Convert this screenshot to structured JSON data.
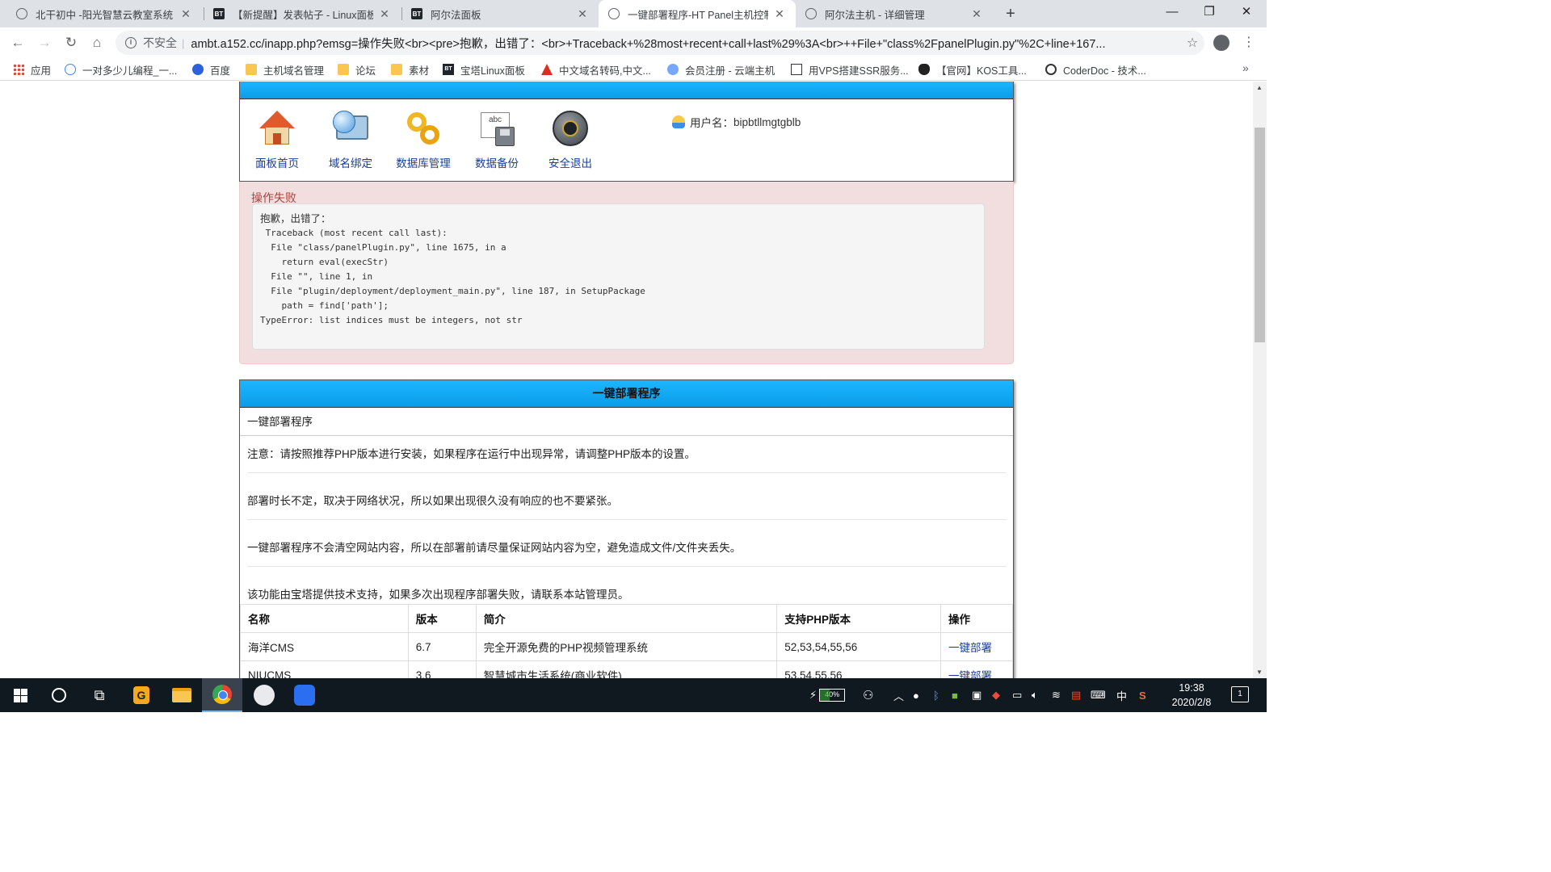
{
  "browser": {
    "tabs": [
      {
        "title": "北干初中 -阳光智慧云教室系统",
        "icon": "globe-icon"
      },
      {
        "title": "【新提醒】发表帖子 - Linux面板",
        "icon": "bt-icon"
      },
      {
        "title": "阿尔法面板",
        "icon": "bt-icon"
      },
      {
        "title": "一键部署程序-HT Panel主机控制",
        "icon": "globe-icon"
      },
      {
        "title": "阿尔法主机 - 详细管理",
        "icon": "globe-icon"
      }
    ],
    "active_tab": 3,
    "insecure_label": "不安全",
    "url": "ambt.a152.cc/inapp.php?emsg=操作失败<br><pre>抱歉，出错了：<br>+Traceback+%28most+recent+call+last%29%3A<br>++File+\"class%2FpanelPlugin.py\"%2C+line+167...",
    "bookmarks": [
      {
        "label": "应用",
        "icon": "apps-icon"
      },
      {
        "label": "一对多少儿编程_一...",
        "icon": "globe-icon"
      },
      {
        "label": "百度",
        "icon": "paw-icon"
      },
      {
        "label": "主机域名管理",
        "icon": "folder-icon"
      },
      {
        "label": "论坛",
        "icon": "folder-icon"
      },
      {
        "label": "素材",
        "icon": "folder-icon"
      },
      {
        "label": "宝塔Linux面板",
        "icon": "bt-icon"
      },
      {
        "label": "中文域名转码,中文...",
        "icon": "red-icon"
      },
      {
        "label": "会员注册 - 云端主机",
        "icon": "cloud-icon"
      },
      {
        "label": "用VPS搭建SSR服务...",
        "icon": "doc-icon"
      },
      {
        "label": "【官网】KOS工具...",
        "icon": "penguin-icon"
      },
      {
        "label": "CoderDoc - 技术...",
        "icon": "ring-icon"
      }
    ]
  },
  "panel_nav": {
    "items": [
      {
        "label": "面板首页",
        "icon": "home-icon"
      },
      {
        "label": "域名绑定",
        "icon": "globe-monitor-icon"
      },
      {
        "label": "数据库管理",
        "icon": "chain-icon"
      },
      {
        "label": "数据备份",
        "icon": "backup-disk-icon"
      },
      {
        "label": "安全退出",
        "icon": "power-icon"
      }
    ],
    "user_label": "用户名：",
    "username": "bipbtllmgtgblb"
  },
  "error": {
    "title": "操作失败",
    "lines": [
      "抱歉，出错了：",
      " Traceback (most recent call last):",
      "  File \"class/panelPlugin.py\", line 1675, in a",
      "    return eval(execStr)",
      "  File \"\", line 1, in",
      "  File \"plugin/deployment/deployment_main.py\", line 187, in SetupPackage",
      "    path = find['path'];",
      "TypeError: list indices must be integers, not str"
    ]
  },
  "deploy": {
    "header": "一键部署程序",
    "subtitle": "一键部署程序",
    "notes": [
      "注意：请按照推荐PHP版本进行安装，如果程序在运行中出现异常，请调整PHP版本的设置。",
      "部署时长不定，取决于网络状况，所以如果出现很久没有响应的也不要紧张。",
      "一键部署程序不会清空网站内容，所以在部署前请尽量保证网站内容为空，避免造成文件/文件夹丢失。",
      "该功能由宝塔提供技术支持，如果多次出现程序部署失败，请联系本站管理员。"
    ],
    "columns": [
      "名称",
      "版本",
      "简介",
      "支持PHP版本",
      "操作"
    ],
    "rows": [
      {
        "name": "海洋CMS",
        "version": "6.7",
        "desc": "完全开源免费的PHP视频管理系统",
        "php": "52,53,54,55,56",
        "action": "一键部署"
      },
      {
        "name": "NIUCMS",
        "version": "3.6",
        "desc": "智慧城市生活系统(商业软件)",
        "php": "53,54,55,56",
        "action": "一键部署"
      }
    ]
  },
  "taskbar": {
    "battery": "40%",
    "ime": "中",
    "time": "19:38",
    "date": "2020/2/8",
    "notifications": "1"
  },
  "colors": {
    "panel_blue": "#1db5ff",
    "error_bg": "#f2dede",
    "error_text": "#a94442",
    "link": "#1c3f94"
  }
}
